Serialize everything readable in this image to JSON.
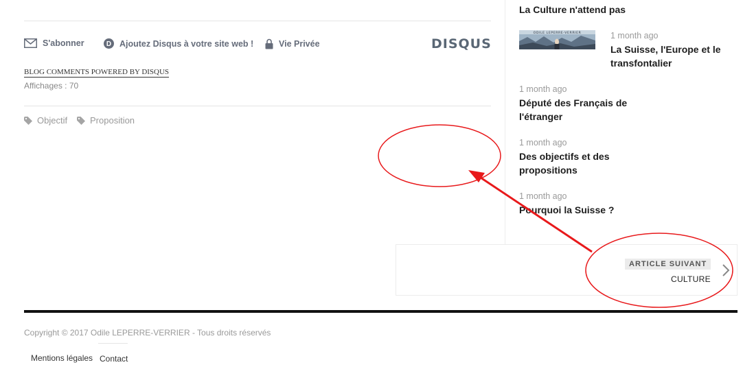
{
  "disqus": {
    "subscribe": "S'abonner",
    "add_disqus": "Ajoutez Disqus à votre site web !",
    "privacy": "Vie Privée",
    "logo": "DISQUS",
    "powered_by": "BLOG COMMENTS POWERED BY DISQUS"
  },
  "post": {
    "views": "Affichages : 70",
    "tags": [
      "Objectif",
      "Proposition"
    ]
  },
  "sidebar": {
    "items": [
      {
        "date": "",
        "title": "La Culture n'attend pas"
      },
      {
        "date": "1 month ago",
        "title_line1": "La Suisse, l'Europe et le",
        "title_line2": "transfontalier",
        "thumb_caption": "ODILE LEPERRE-VERRIER"
      },
      {
        "date": "1 month ago",
        "title_line1": "Député des Français de",
        "title_line2": "l'étranger"
      },
      {
        "date": "1 month ago",
        "title_line1": "Des objectifs et des",
        "title_line2": "propositions"
      },
      {
        "date": "1 month ago",
        "title": "Pourquoi la Suisse ?"
      }
    ]
  },
  "next_article": {
    "label": "ARTICLE SUIVANT",
    "title": "CULTURE"
  },
  "footer": {
    "copyright": "Copyright © 2017 Odile LEPERRE-VERRIER - Tous droits réservés",
    "links": [
      "Mentions légales",
      "Contact"
    ]
  },
  "colors": {
    "annotation": "#e8191b",
    "disqus_gray": "#656c7a"
  }
}
